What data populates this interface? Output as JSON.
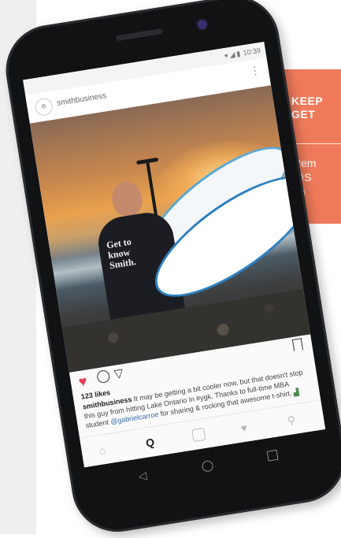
{
  "promo": {
    "headline": "KEEP\nGET",
    "body": "Rem\n@S\non"
  },
  "phone": {
    "status_icons": "▾◢▮",
    "status_time": "10:39",
    "ig_header": {
      "username": "smithbusiness",
      "more_icon": "⋮"
    },
    "post": {
      "shirt_text": "Get to\nknow\nSmith.",
      "likes": "123 likes",
      "caption_user": "smithbusiness",
      "caption_text_1": " It may be getting a bit cooler now, but that doesn't stop this guy from hitting Lake Ontario in #ygk. Thanks to full-time MBA student ",
      "caption_mention": "@gabrielcarroe",
      "caption_text_2": " for sharing & rocking that awesome t-shirt. "
    },
    "icons": {
      "heart": "♥",
      "share": "▽",
      "home": "⌂",
      "search": "Q",
      "activity": "♥",
      "profile": "⚲",
      "back": "◁"
    }
  },
  "colors": {
    "promo_bg": "#ef7a5b",
    "like_red": "#e63a55",
    "phone_body": "#111214"
  }
}
